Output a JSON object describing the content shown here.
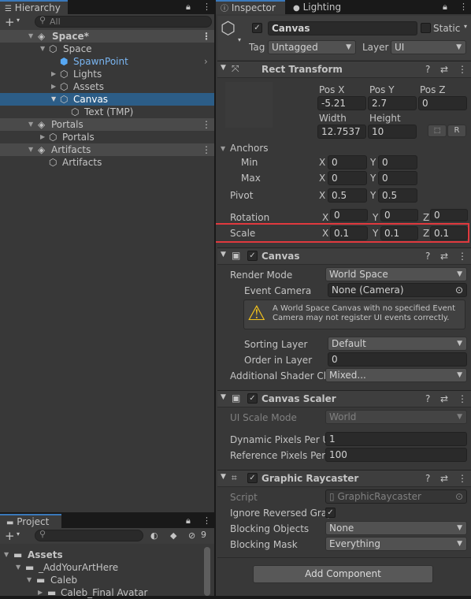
{
  "hierarchy": {
    "tab_label": "Hierarchy",
    "search_placeholder": "All",
    "rows": [
      {
        "label": "Space*",
        "kind": "scene"
      },
      {
        "label": "Space",
        "kind": "object"
      },
      {
        "label": "SpawnPoint",
        "kind": "prefab"
      },
      {
        "label": "Lights",
        "kind": "object"
      },
      {
        "label": "Assets",
        "kind": "object"
      },
      {
        "label": "Canvas",
        "kind": "selected"
      },
      {
        "label": "Text (TMP)",
        "kind": "object"
      },
      {
        "label": "Portals",
        "kind": "scene"
      },
      {
        "label": "Portals",
        "kind": "object"
      },
      {
        "label": "Artifacts",
        "kind": "scene"
      },
      {
        "label": "Artifacts",
        "kind": "object"
      }
    ]
  },
  "project": {
    "tab_label": "Project",
    "hidden_count": "9",
    "tree": [
      "Assets",
      "_AddYourArtHere",
      "Caleb",
      "Caleb_Final Avatar"
    ]
  },
  "inspector": {
    "tabs": [
      "Inspector",
      "Lighting"
    ],
    "object_name": "Canvas",
    "static_label": "Static",
    "tag_label": "Tag",
    "tag_value": "Untagged",
    "layer_label": "Layer",
    "layer_value": "UI",
    "rect_transform": {
      "title": "Rect Transform",
      "pos_x_label": "Pos X",
      "pos_y_label": "Pos Y",
      "pos_z_label": "Pos Z",
      "pos_x": "-5.21",
      "pos_y": "2.7",
      "pos_z": "0",
      "width_label": "Width",
      "height_label": "Height",
      "width": "12.7537",
      "height": "10",
      "r_button": "R",
      "anchors_label": "Anchors",
      "min_label": "Min",
      "max_label": "Max",
      "min_x": "0",
      "min_y": "0",
      "max_x": "0",
      "max_y": "0",
      "pivot_label": "Pivot",
      "pivot_x": "0.5",
      "pivot_y": "0.5",
      "rotation_label": "Rotation",
      "rot_x": "0",
      "rot_y": "0",
      "rot_z": "0",
      "scale_label": "Scale",
      "scale_x": "0.1",
      "scale_y": "0.1",
      "scale_z": "0.1",
      "x": "X",
      "y": "Y",
      "z": "Z"
    },
    "canvas": {
      "title": "Canvas",
      "render_mode_label": "Render Mode",
      "render_mode": "World Space",
      "event_camera_label": "Event Camera",
      "event_camera": "None (Camera)",
      "warning": "A World Space Canvas with no specified Event Camera may not register UI events correctly.",
      "sorting_layer_label": "Sorting Layer",
      "sorting_layer": "Default",
      "order_label": "Order in Layer",
      "order": "0",
      "shader_label": "Additional Shader Ch",
      "shader": "Mixed..."
    },
    "canvas_scaler": {
      "title": "Canvas Scaler",
      "ui_scale_label": "UI Scale Mode",
      "ui_scale": "World",
      "dyn_label": "Dynamic Pixels Per U",
      "dyn": "1",
      "ref_label": "Reference Pixels Per",
      "ref": "100"
    },
    "graphic_raycaster": {
      "title": "Graphic Raycaster",
      "script_label": "Script",
      "script": "GraphicRaycaster",
      "ignore_label": "Ignore Reversed Grap",
      "blocking_objects_label": "Blocking Objects",
      "blocking_objects": "None",
      "blocking_mask_label": "Blocking Mask",
      "blocking_mask": "Everything"
    },
    "add_component": "Add Component"
  },
  "colors": {
    "selection": "#2c5d87",
    "highlight_box": "#e0393e",
    "tab_accent": "#3a79bb",
    "prefab_text": "#7ab6f2"
  }
}
